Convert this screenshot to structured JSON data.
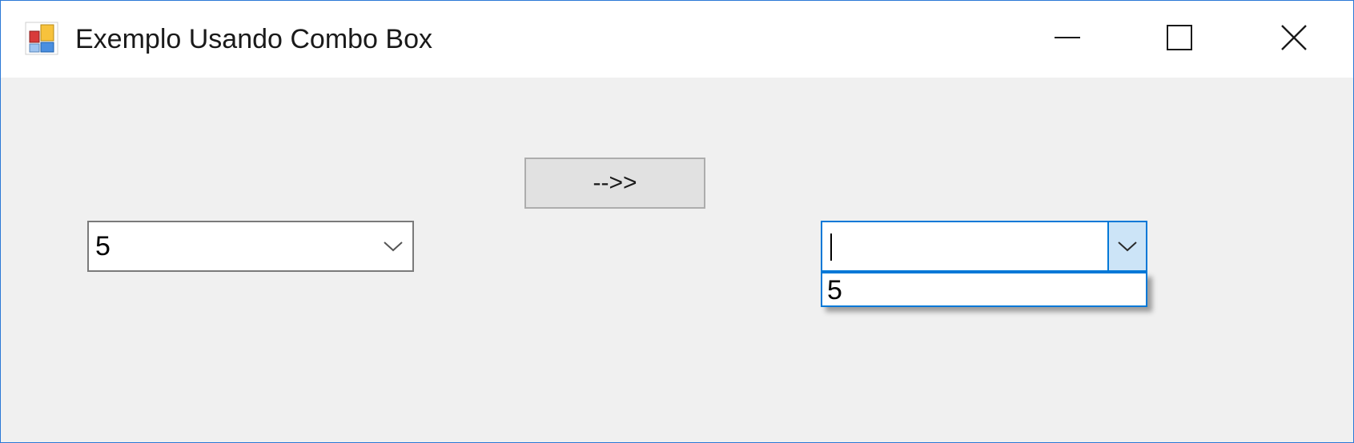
{
  "window": {
    "title": "Exemplo Usando Combo Box",
    "accent_color": "#0078d7",
    "border_color": "#2b79d6"
  },
  "caption_buttons": {
    "minimize_icon": "minimize-icon",
    "maximize_icon": "maximize-icon",
    "close_icon": "close-icon"
  },
  "form": {
    "left_combo": {
      "value": "5",
      "icon": "chevron-down-icon"
    },
    "transfer_button": {
      "label": "-->>"
    },
    "right_combo": {
      "value": "",
      "icon": "chevron-down-icon",
      "dropdown_open": true,
      "options": [
        "5"
      ]
    }
  }
}
